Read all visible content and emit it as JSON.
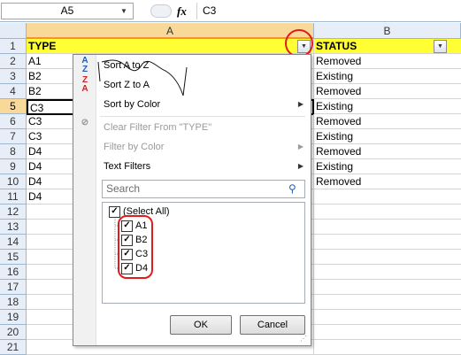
{
  "formula_bar": {
    "name_box": "A5",
    "fx_label": "fx",
    "formula": "C3"
  },
  "columns": [
    "A",
    "B"
  ],
  "rows": [
    "1",
    "2",
    "3",
    "4",
    "5",
    "6",
    "7",
    "8",
    "9",
    "10",
    "11",
    "12",
    "13",
    "14",
    "15",
    "16",
    "17",
    "18",
    "19",
    "20",
    "21"
  ],
  "header_row": {
    "a": "TYPE",
    "b": "STATUS"
  },
  "data_rows": [
    {
      "a": "A1",
      "b": "Removed"
    },
    {
      "a": "B2",
      "b": "Existing"
    },
    {
      "a": "B2",
      "b": "Removed"
    },
    {
      "a": "C3",
      "b": "Existing"
    },
    {
      "a": "C3",
      "b": "Removed"
    },
    {
      "a": "C3",
      "b": "Existing"
    },
    {
      "a": "D4",
      "b": "Removed"
    },
    {
      "a": "D4",
      "b": "Existing"
    },
    {
      "a": "D4",
      "b": "Removed"
    },
    {
      "a": "D4",
      "b": ""
    }
  ],
  "menu": {
    "sort_az": "Sort A to Z",
    "sort_za": "Sort Z to A",
    "sort_color": "Sort by Color",
    "clear_filter": "Clear Filter From \"TYPE\"",
    "filter_color": "Filter by Color",
    "text_filters": "Text Filters",
    "search_placeholder": "Search",
    "select_all": "(Select All)",
    "values": [
      "A1",
      "B2",
      "C3",
      "D4"
    ],
    "ok": "OK",
    "cancel": "Cancel"
  },
  "colors": {
    "highlight": "#ffff33",
    "annotation": "#e21b1b"
  }
}
